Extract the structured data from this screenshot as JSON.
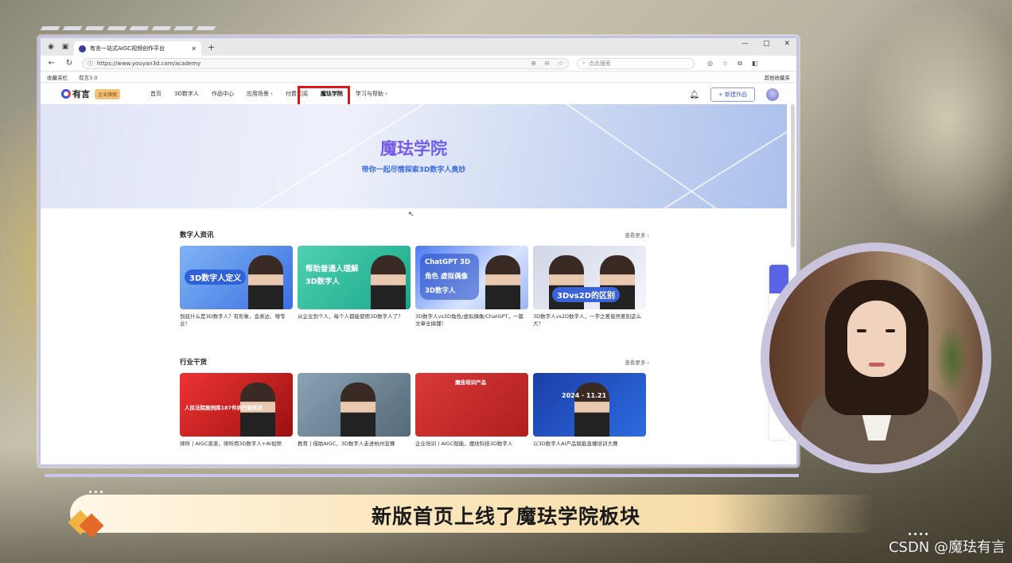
{
  "browser": {
    "tab_title": "有言一站式AIGC视频创作平台",
    "url": "https://www.youyan3d.com/academy",
    "search_placeholder": "点此搜索",
    "bookmarks": [
      "收藏夹栏",
      "有言3.0"
    ],
    "other_bookmarks": "其他收藏夹"
  },
  "site": {
    "logo_text": "有言",
    "enterprise_badge": "企业旗舰",
    "nav": [
      "首页",
      "3D数字人",
      "作品中心",
      "应用场景 ›",
      "付费订阅",
      "魔珐学院",
      "学习与帮助 ›"
    ],
    "active_nav": "魔珐学院",
    "create_button": "+ 新建作品",
    "banner": {
      "title": "魔珐学院",
      "subtitle": "带你一起尽情探索3D数字人奥妙"
    },
    "sections": [
      {
        "title": "数字人资讯",
        "more": "查看更多 ›",
        "cards": [
          {
            "caption": "3D数字人定义",
            "desc": "到底什么是3D数字人？有形象、会表达、够专业！"
          },
          {
            "caption": "帮助普通人理解 3D数字人",
            "desc": "从企业到个人，每个人都能使用3D数字人了？"
          },
          {
            "caption": "ChatGPT 3D角色 虚拟偶像 3D数字人",
            "desc": "3D数字人vs3D角色/虚拟偶像/ChatGPT，一篇文章全搞懂！"
          },
          {
            "caption": "3Dvs2D的区别",
            "desc": "3D数字人vs2D数字人，一字之差竟然差别这么大？"
          }
        ]
      },
      {
        "title": "行业干货",
        "more": "查看更多 ›",
        "cards": [
          {
            "caption": "人民法院案例库187件执行案例发",
            "desc": "律所 | AIGC滚滚，律所用3D数字人+AI视频"
          },
          {
            "caption": "",
            "desc": "教育 | 借助AIGC，3D数字人走进杭州宣赛"
          },
          {
            "caption": "魔佳培训产品",
            "desc": "企业培训 | AIGC赋能，魔珐科技3D数字人"
          },
          {
            "caption": "2024 · 11.21",
            "desc": "以3D数字人AI产品赋能直播培训大赛"
          }
        ]
      }
    ]
  },
  "overlay": {
    "caption": "新版首页上线了魔珐学院板块",
    "watermark": "CSDN @魔珐有言"
  },
  "colors": {
    "highlight": "#e0161b",
    "accent_blue": "#3a6be0",
    "brand_purple": "#a83be8"
  }
}
